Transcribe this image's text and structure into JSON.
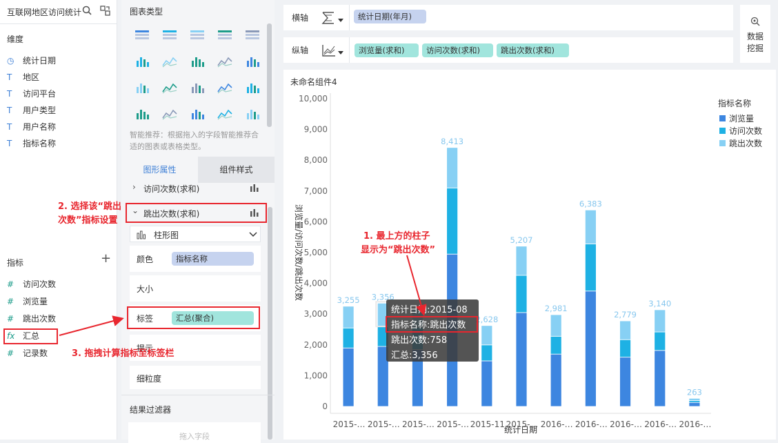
{
  "left_panel": {
    "title": "互联网地区访问统计",
    "dimension_header": "维度",
    "dimensions": [
      {
        "label": "统计日期",
        "icon": "clock-icon"
      },
      {
        "label": "地区",
        "icon": "text-type-icon"
      },
      {
        "label": "访问平台",
        "icon": "text-type-icon"
      },
      {
        "label": "用户类型",
        "icon": "text-type-icon"
      },
      {
        "label": "用户名称",
        "icon": "text-type-icon"
      },
      {
        "label": "指标名称",
        "icon": "text-type-icon"
      }
    ],
    "measure_header": "指标",
    "measures": [
      {
        "label": "访问次数",
        "icon": "hash-icon"
      },
      {
        "label": "浏览量",
        "icon": "hash-icon"
      },
      {
        "label": "跳出次数",
        "icon": "hash-icon"
      },
      {
        "label": "汇总",
        "icon": "fx-icon"
      },
      {
        "label": "记录数",
        "icon": "hash-icon"
      }
    ]
  },
  "middle_panel": {
    "chart_type_header": "图表类型",
    "smart_hint": "智能推荐：根据拖入的字段智能推荐合适的图表或表格类型。",
    "tabs": [
      "图形属性",
      "组件样式"
    ],
    "active_tab": "图形属性",
    "visit_row": "访问次数(求和)",
    "bounce_row": "跳出次数(求和)",
    "chart_select": "柱形图",
    "color_label": "颜色",
    "color_value": "指标名称",
    "size_label": "大小",
    "label_label": "标签",
    "label_value": "汇总(聚合)",
    "tooltip_label": "提示",
    "granularity_label": "细粒度",
    "result_filter": "结果过滤器",
    "drop_hint": "拖入字段"
  },
  "axes_bar": {
    "x_label": "横轴",
    "x_field": "统计日期(年月)",
    "y_label": "纵轴",
    "y_fields": [
      "浏览量(求和)",
      "访问次数(求和)",
      "跳出次数(求和)"
    ],
    "data_mining": [
      "数据",
      "挖掘"
    ]
  },
  "chart_data": {
    "type": "bar",
    "title": "未命名组件4",
    "xlabel": "统计日期",
    "ylabel": "浏览量/访问次数/跳出次数",
    "ylim": [
      0,
      10000
    ],
    "yticks": [
      "0",
      "1,000",
      "2,000",
      "3,000",
      "4,000",
      "5,000",
      "6,000",
      "7,000",
      "8,000",
      "9,000",
      "10,000"
    ],
    "categories": [
      "2015-…",
      "2015-…",
      "2015-…",
      "2015-…",
      "2015-11",
      "2015-…",
      "2016-…",
      "2016-…",
      "2016-…",
      "2016-…",
      "2016-…"
    ],
    "stacked": true,
    "series": [
      {
        "name": "浏览量",
        "color": "#3d86e0",
        "values": [
          1900,
          1950,
          1850,
          4950,
          1480,
          3050,
          1700,
          3750,
          1600,
          1820,
          130
        ]
      },
      {
        "name": "访问次数",
        "color": "#1eb1e4",
        "values": [
          650,
          648,
          720,
          2150,
          520,
          1210,
          580,
          1530,
          570,
          600,
          60
        ]
      },
      {
        "name": "跳出次数",
        "color": "#87d0f4",
        "values": [
          705,
          758,
          600,
          1313,
          628,
          947,
          701,
          1103,
          609,
          720,
          73
        ]
      }
    ],
    "totals": [
      "3,255",
      "3,356",
      "",
      "8,413",
      "2,628",
      "5,207",
      "2,981",
      "6,383",
      "2,779",
      "3,140",
      "263"
    ],
    "legend_title": "指标名称",
    "legend_position": "right",
    "highlighted_index": 1
  },
  "tooltip": {
    "line1": "统计日期:2015-08",
    "line2": "指标名称:跳出次数",
    "line3": "跳出次数:758",
    "line4": "汇总:3,356"
  },
  "annotations": {
    "a1": [
      "1. 最上方的柱子",
      "显示为“跳出次数”"
    ],
    "a2": [
      "2. 选择该“跳出",
      "次数”指标设置"
    ],
    "a3": "3. 拖拽计算指标至标签栏"
  },
  "colors": {
    "accent": "#3d7fd6",
    "annotation": "#e8262e"
  }
}
